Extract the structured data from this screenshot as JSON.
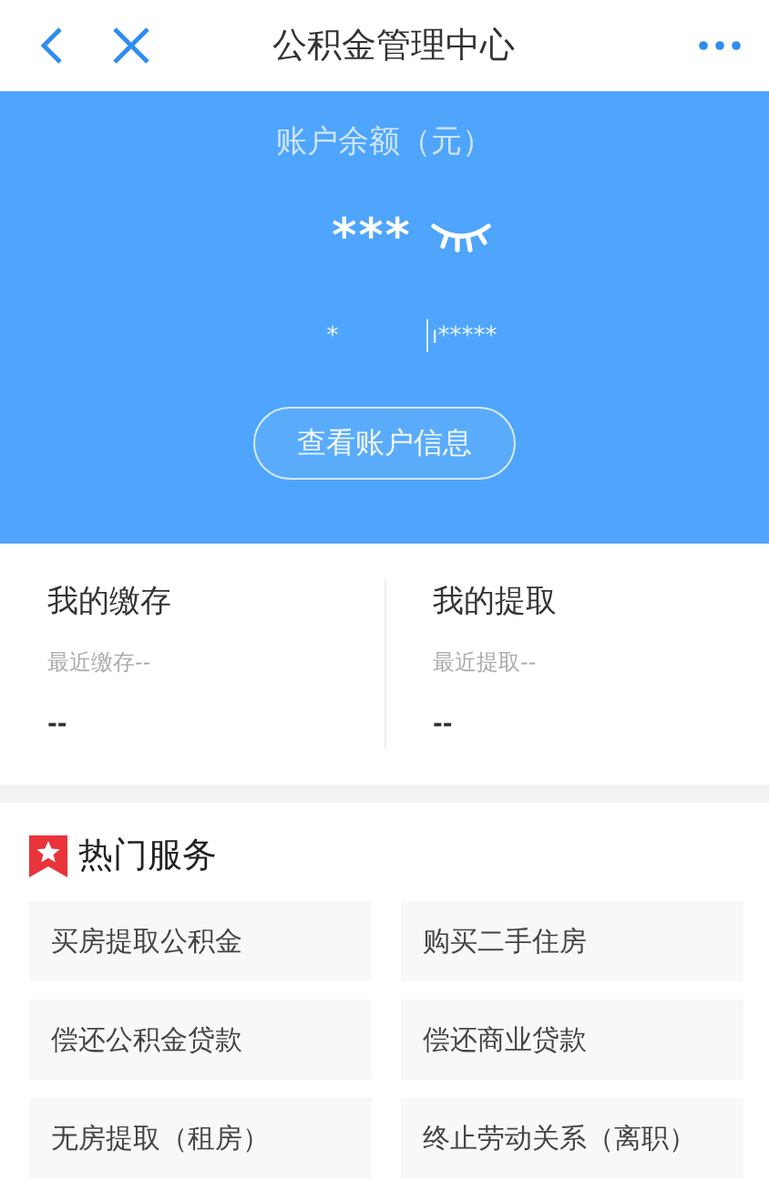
{
  "nav": {
    "title": "公积金管理中心"
  },
  "account": {
    "label": "账户余额（元）",
    "balance": "***",
    "balance_hidden": true,
    "name_masked": "*",
    "number_masked": "ı*****",
    "button": "查看账户信息"
  },
  "summary": [
    {
      "title": "我的缴存",
      "subtitle": "最近缴存--",
      "value": "--"
    },
    {
      "title": "我的提取",
      "subtitle": "最近提取--",
      "value": "--"
    }
  ],
  "services": {
    "title": "热门服务",
    "items": [
      "买房提取公积金",
      "购买二手住房",
      "偿还公积金贷款",
      "偿还商业贷款",
      "无房提取（租房）",
      "终止劳动关系（离职）"
    ]
  }
}
